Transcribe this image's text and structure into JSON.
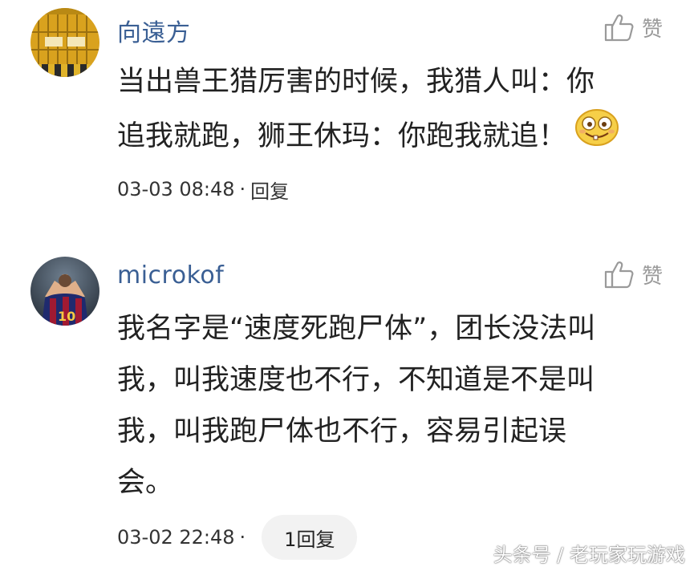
{
  "comments": [
    {
      "username": "向遠方",
      "like_label": "赞",
      "lines": [
        "当出兽王猎厉害的时候，我猎人叫：你",
        "追我就跑，狮王休玛：你跑我就追！"
      ],
      "timestamp": "03-03 08:48",
      "separator": "·",
      "reply_label": "回复",
      "emoji_icon": "grinning-emoji-icon"
    },
    {
      "username": "microkof",
      "like_label": "赞",
      "lines": [
        "我名字是“速度死跑尸体”，团长没法叫",
        "我，叫我速度也不行，不知道是不是叫",
        "我，叫我跑尸体也不行，容易引起误",
        "会。"
      ],
      "timestamp": "03-02 22:48",
      "separator": "·",
      "reply_label": "1回复"
    }
  ],
  "watermark": "头条号 / 老玩家玩游戏",
  "colors": {
    "username": "#3a5f94",
    "muted": "#9a9a9a",
    "pill": "#f2f2f2"
  }
}
